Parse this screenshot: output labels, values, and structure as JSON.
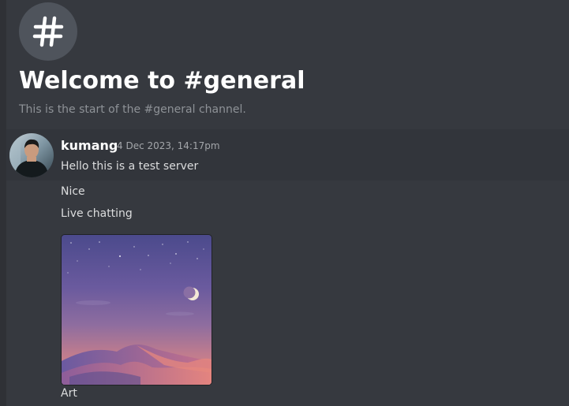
{
  "channel": {
    "icon": "hash-icon",
    "welcome_title": "Welcome to #general",
    "welcome_subtitle": "This is the start of the #general channel."
  },
  "messages": [
    {
      "author": "kumang",
      "avatar": "user-avatar",
      "timestamp": "4 Dec 2023, 14:17pm",
      "lines": [
        "Hello this is a test server",
        "Nice",
        "Live chatting"
      ],
      "attachment": {
        "type": "image",
        "icon": "desert-night-landscape-image",
        "caption": "Art"
      }
    }
  ],
  "colors": {
    "background": "#36393f",
    "hover_row": "#32353b",
    "username": "#ffffff",
    "text": "#dcddde",
    "muted": "#8e9297"
  }
}
